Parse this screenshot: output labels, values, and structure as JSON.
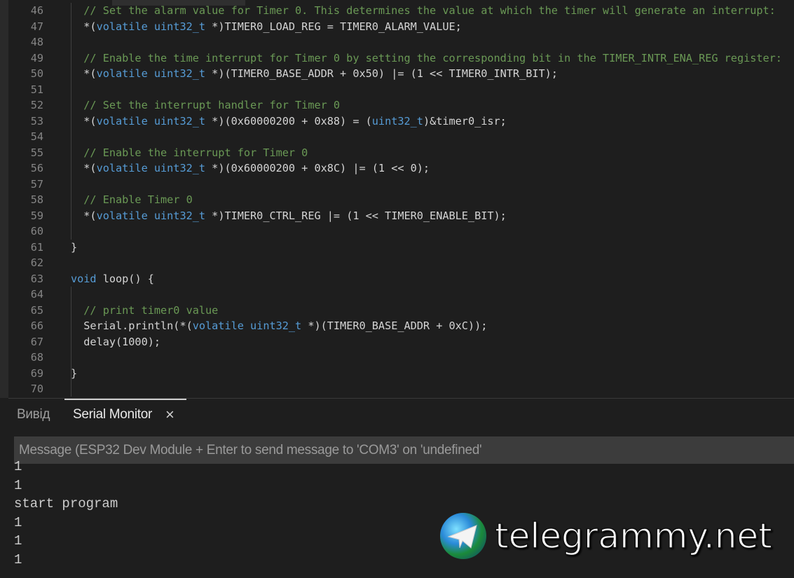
{
  "editor": {
    "lines": [
      {
        "n": "46",
        "t": [
          [
            "  // Set the alarm value for Timer 0. This determines the value at which the timer will generate an interrupt:",
            "c"
          ]
        ]
      },
      {
        "n": "47",
        "t": [
          [
            "  *(",
            "p"
          ],
          [
            "volatile uint32_t",
            "k"
          ],
          [
            " *)TIMER0_LOAD_REG = TIMER0_ALARM_VALUE;",
            "p"
          ]
        ]
      },
      {
        "n": "48",
        "t": []
      },
      {
        "n": "49",
        "t": [
          [
            "  // Enable the time interrupt for Timer 0 by setting the corresponding bit in the TIMER_INTR_ENA_REG register:",
            "c"
          ]
        ]
      },
      {
        "n": "50",
        "t": [
          [
            "  *(",
            "p"
          ],
          [
            "volatile uint32_t",
            "k"
          ],
          [
            " *)(TIMER0_BASE_ADDR + 0x50) |= (1 << TIMER0_INTR_BIT);",
            "p"
          ]
        ]
      },
      {
        "n": "51",
        "t": []
      },
      {
        "n": "52",
        "t": [
          [
            "  // Set the interrupt handler for Timer 0",
            "c"
          ]
        ]
      },
      {
        "n": "53",
        "t": [
          [
            "  *(",
            "p"
          ],
          [
            "volatile uint32_t",
            "k"
          ],
          [
            " *)(0x60000200 + 0x88) = (",
            "p"
          ],
          [
            "uint32_t",
            "k"
          ],
          [
            ")&timer0_isr;",
            "p"
          ]
        ]
      },
      {
        "n": "54",
        "t": []
      },
      {
        "n": "55",
        "t": [
          [
            "  // Enable the interrupt for Timer 0",
            "c"
          ]
        ]
      },
      {
        "n": "56",
        "t": [
          [
            "  *(",
            "p"
          ],
          [
            "volatile uint32_t",
            "k"
          ],
          [
            " *)(0x60000200 + 0x8C) |= (1 << 0);",
            "p"
          ]
        ]
      },
      {
        "n": "57",
        "t": []
      },
      {
        "n": "58",
        "t": [
          [
            "  // Enable Timer 0",
            "c"
          ]
        ]
      },
      {
        "n": "59",
        "t": [
          [
            "  *(",
            "p"
          ],
          [
            "volatile uint32_t",
            "k"
          ],
          [
            " *)TIMER0_CTRL_REG |= (1 << TIMER0_ENABLE_BIT);",
            "p"
          ]
        ]
      },
      {
        "n": "60",
        "t": []
      },
      {
        "n": "61",
        "t": [
          [
            "}",
            "p"
          ]
        ]
      },
      {
        "n": "62",
        "t": []
      },
      {
        "n": "63",
        "t": [
          [
            "void",
            "k"
          ],
          [
            " loop() {",
            "p"
          ]
        ]
      },
      {
        "n": "64",
        "t": []
      },
      {
        "n": "65",
        "t": [
          [
            "  // print timer0 value",
            "c"
          ]
        ]
      },
      {
        "n": "66",
        "t": [
          [
            "  Serial.println(*(",
            "p"
          ],
          [
            "volatile uint32_t",
            "k"
          ],
          [
            " *)(TIMER0_BASE_ADDR + 0xC));",
            "p"
          ]
        ]
      },
      {
        "n": "67",
        "t": [
          [
            "  delay(1000);",
            "p"
          ]
        ]
      },
      {
        "n": "68",
        "t": []
      },
      {
        "n": "69",
        "t": [
          [
            "}",
            "p"
          ]
        ]
      },
      {
        "n": "70",
        "t": []
      }
    ]
  },
  "panel": {
    "tabs": [
      {
        "label": "Вивід"
      },
      {
        "label": "Serial Monitor"
      }
    ],
    "close_icon": "×",
    "message_placeholder": "Message (ESP32 Dev Module + Enter to send message to 'COM3' on 'undefined'",
    "output": [
      "1",
      "1",
      "start program",
      "1",
      "1",
      "1"
    ]
  },
  "watermark": {
    "text": "telegrammy.net"
  },
  "colors": {
    "comment": "#6a9955",
    "keyword": "#569cd6",
    "text": "#d4d4d4",
    "background": "#1e1e1e"
  }
}
